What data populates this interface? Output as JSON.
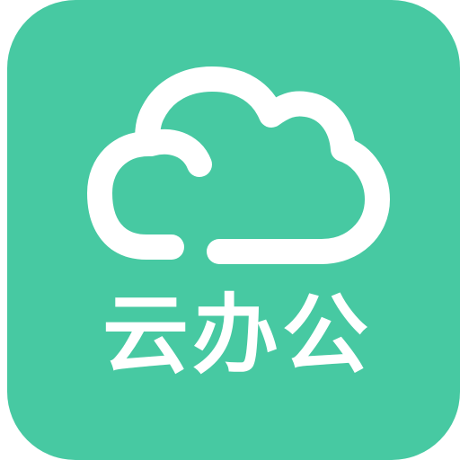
{
  "app": {
    "name": "云办公"
  },
  "icon": {
    "glyph": "cloud-icon"
  },
  "colors": {
    "background": "#47c9a2",
    "foreground": "#ffffff"
  }
}
